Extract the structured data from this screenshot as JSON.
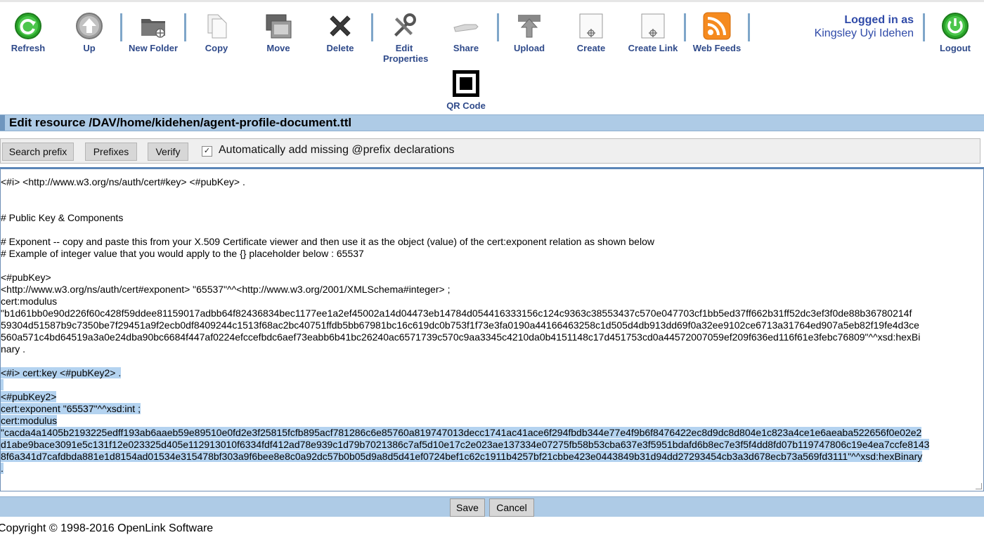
{
  "toolbar": {
    "items": [
      {
        "label": "Refresh",
        "icon": "refresh-icon"
      },
      {
        "label": "Up",
        "icon": "up-arrow-icon"
      },
      {
        "label": "New Folder",
        "icon": "new-folder-icon"
      },
      {
        "label": "Copy",
        "icon": "copy-icon"
      },
      {
        "label": "Move",
        "icon": "move-icon"
      },
      {
        "label": "Delete",
        "icon": "delete-icon"
      },
      {
        "label": "Edit Properties",
        "icon": "tools-icon"
      },
      {
        "label": "Share",
        "icon": "share-hand-icon"
      },
      {
        "label": "Upload",
        "icon": "upload-icon"
      },
      {
        "label": "Create",
        "icon": "create-icon"
      },
      {
        "label": "Create Link",
        "icon": "create-link-icon"
      },
      {
        "label": "Web Feeds",
        "icon": "rss-icon"
      },
      {
        "label": "QR Code",
        "icon": "qr-code-icon"
      },
      {
        "label": "Logout",
        "icon": "power-icon"
      }
    ],
    "logged_in_as": "Logged in as",
    "user_name": "Kingsley Uyi Idehen"
  },
  "page": {
    "title": "Edit resource /DAV/home/kidehen/agent-profile-document.ttl"
  },
  "actions": {
    "search_prefix": "Search prefix",
    "prefixes": "Prefixes",
    "verify": "Verify",
    "auto_prefix_label": "Automatically add missing @prefix declarations",
    "auto_prefix_checked": true
  },
  "editor": {
    "lines": [
      "<#i> <http://www.w3.org/ns/auth/cert#key> <#pubKey> .",
      "",
      "",
      "# Public Key & Components",
      "",
      "# Exponent -- copy and paste this from your X.509 Certificate viewer and then use it as the object (value) of the cert:exponent relation as shown below",
      "# Example of integer value that you would apply to the {} placeholder below : 65537",
      "",
      "<#pubKey>",
      "<http://www.w3.org/ns/auth/cert#exponent> \"65537\"^^<http://www.w3.org/2001/XMLSchema#integer> ;",
      "cert:modulus",
      "\"b1d61bb0e90d226f60c428f59ddee81159017adbb64f82436834bec1177ee1a2ef45002a14d04473eb14784d054416333156c124c9363c38553437c570e047703cf1bb5ed37ff662b31ff52dc3ef3f0de88b36780214f",
      "59304d51587b9c7350be7f29451a9f2ecb0df8409244c1513f68ac2bc40751ffdb5bb67981bc16c619dc0b753f1f73e3fa0190a44166463258c1d505d4db913dd69f0a32ee9102ce6713a31764ed907a5eb82f19fe4d3ce",
      "560a571c4bd64519a3a0e24dba90bc6684f447af0224efccefbdc6aef73eabb6b41bc26240ac6571739c570c9aa3345c4210da0b4151148c17d451753cd0a44572007059ef209f636ed116f61e3febc76809\"^^xsd:hexBi",
      "nary .",
      "",
      "<#i> cert:key <#pubKey2> .",
      " ",
      "<#pubKey2>",
      "cert:exponent \"65537\"^^xsd:int ;",
      "cert:modulus",
      "\"cacda4a1405b2193225edff193ab6aaeb59e89510e0fd2e3f25815fcfb895acf781286c6e85760a819747013decc1741ac41ace6f294fbdb344e77e4f9b6f8476422ec8d9dc8d804e1c823a4ce1e6aeaba522656f0e02e2",
      "d1abe9bace3091e5c131f12e023325d405e112913010f6334fdf412ad78e939c1d79b7021386c7af5d10e17c2e023ae137334e07275fb58b53cba637e3f5951bdafd6b8ec7e3f5f4dd8fd07b119747806c19e4ea7ccfe8143",
      "8f6a341d7cafdbda881e1d8154ad01534e315478bf303a9f6bee8e8c0a92dc57b0b05d9a8d5d41ef0724bef1c62c1911b4257bf21cbbe423e0443849b31d94dd27293454cb3a3d678ecb73a569fd3111\"^^xsd:hexBinary",
      "."
    ]
  },
  "footer": {
    "save": "Save",
    "cancel": "Cancel",
    "copyright": "Copyright © 1998-2016 OpenLink Software"
  },
  "colors": {
    "link_blue": "#2f4a8a",
    "bar_blue": "#aecbe6",
    "selection": "#b4d3f0"
  }
}
